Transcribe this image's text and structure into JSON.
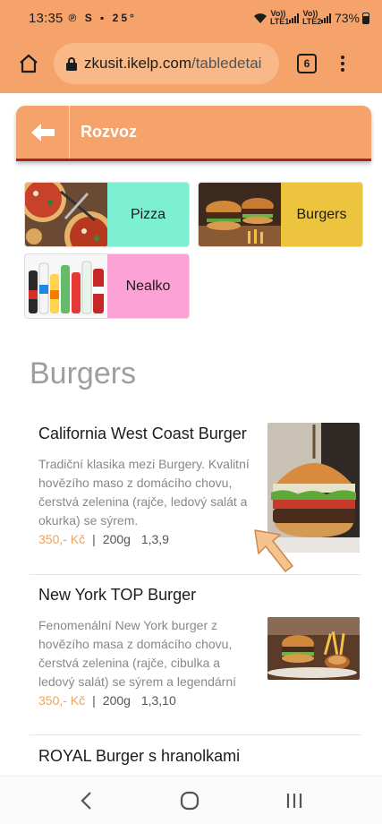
{
  "status": {
    "time": "13:35",
    "notif": "℗ S ▪ 25°",
    "sim1": "Vo)) LTE1",
    "sim2": "Vo)) LTE2",
    "battery": "73%"
  },
  "browser": {
    "url_host": "zkusit.ikelp.com",
    "url_path": "/tabledetai",
    "tab_count": "6"
  },
  "header": {
    "title": "Rozvoz"
  },
  "categories": [
    {
      "label": "Pizza",
      "color": "#7ef0d2"
    },
    {
      "label": "Burgers",
      "color": "#ecc43e"
    },
    {
      "label": "Nealko",
      "color": "#fca2d6"
    }
  ],
  "section": {
    "title": "Burgers"
  },
  "items": [
    {
      "name": "California West Coast Burger",
      "desc": "Tradiční klasika mezi Burgery. Kvalitní hovězího maso z domácího chovu, čerstvá zelenina (rajče, ledový salát a okurka) se sýrem.",
      "price": "350,- Kč",
      "weight": "200g",
      "allergens": "1,3,9"
    },
    {
      "name": "New York TOP Burger",
      "desc": "Fenomenální New York burger z hovězího masa z domácího chovu, čerstvá zelenina (rajče, cibulka a ledový salát) se sýrem a legendární",
      "price": "350,- Kč",
      "weight": "200g",
      "allergens": "1,3,10"
    },
    {
      "name": "ROYAL Burger s hranolkami"
    }
  ],
  "meta_separator": "|",
  "icons": {
    "home": "home-icon",
    "lock": "lock-icon",
    "menu": "more-vert-icon",
    "back": "arrow-left-icon",
    "nav_back": "chevron-left-icon",
    "nav_home": "circle-home-icon",
    "nav_recents": "recents-icon"
  },
  "colors": {
    "brand": "#f5a36b",
    "accent_border": "#a5262a",
    "price": "#e9a35c",
    "pointer": "#f6c28f"
  }
}
